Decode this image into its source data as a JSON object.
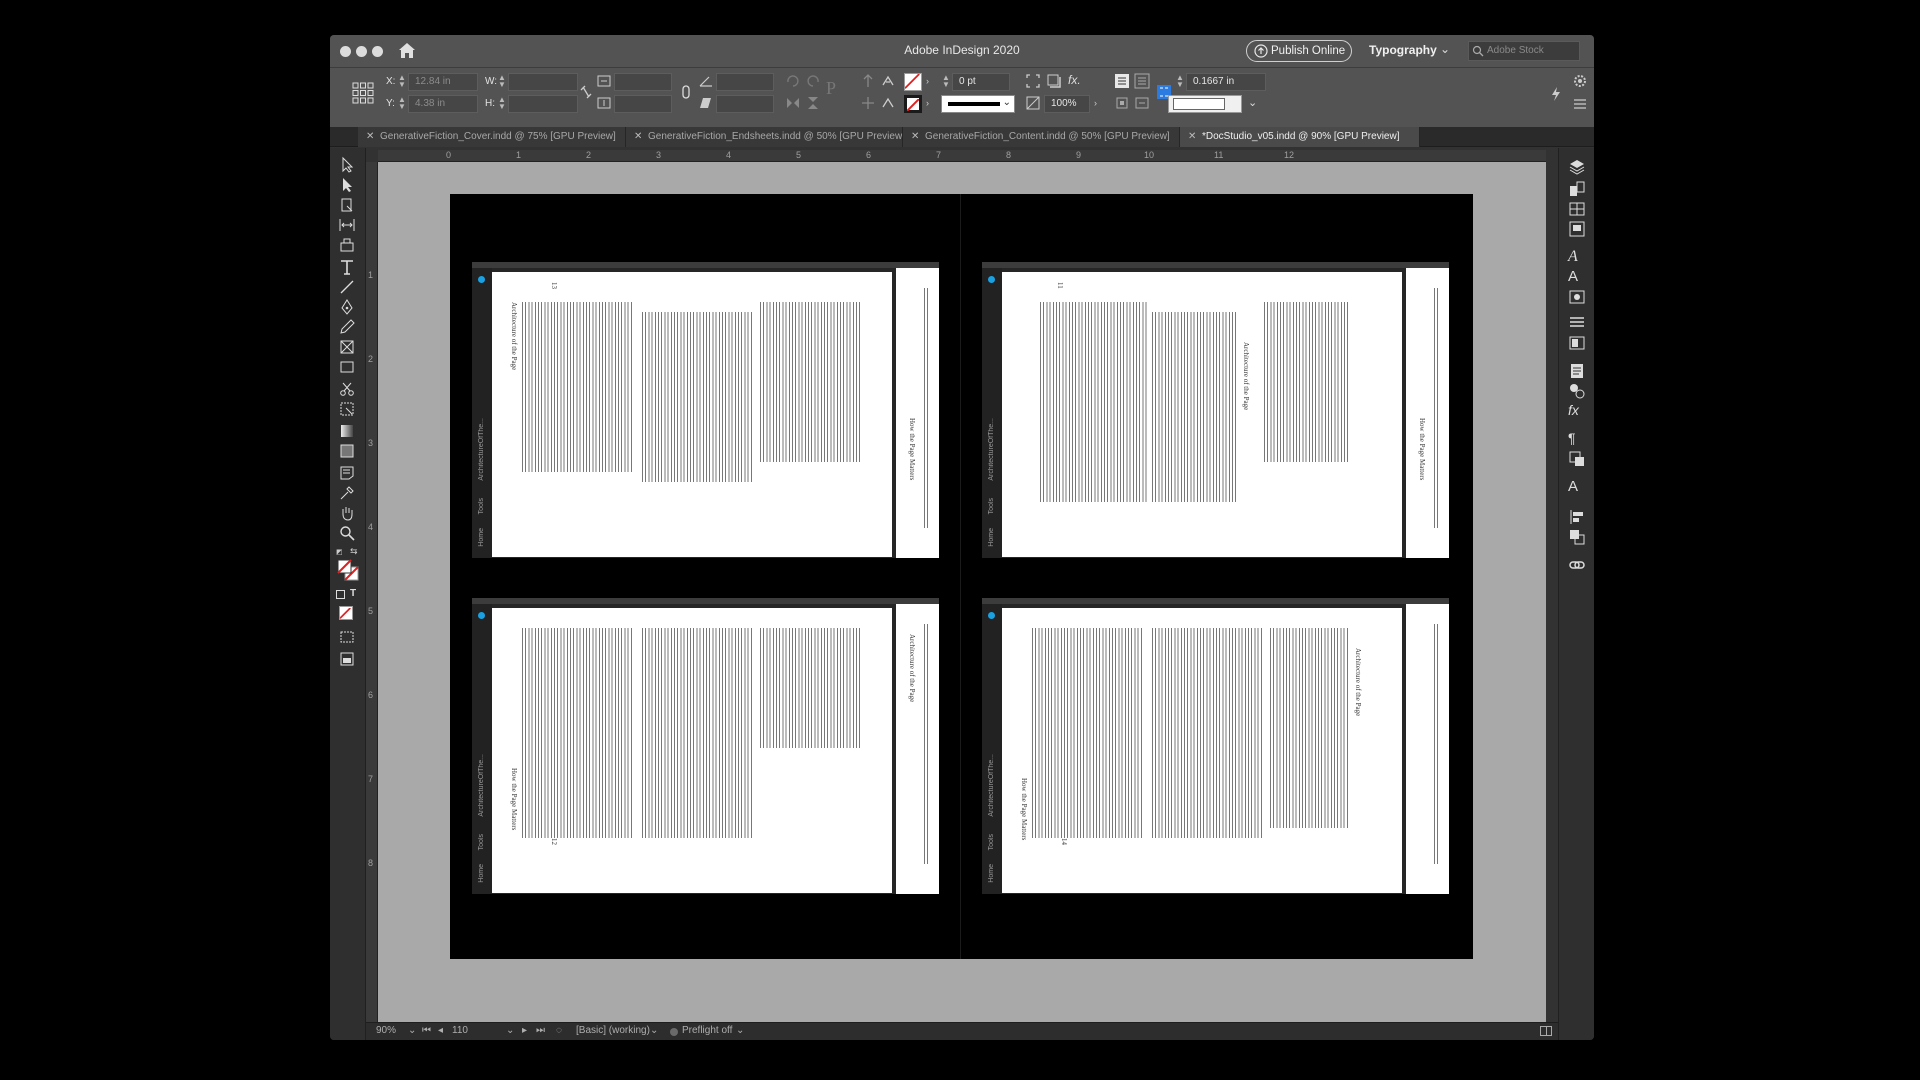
{
  "titlebar": {
    "title": "Adobe InDesign 2020",
    "publish_label": "Publish Online",
    "workspace_label": "Typography",
    "stock_placeholder": "Adobe Stock"
  },
  "control": {
    "x_label": "X:",
    "x_value": "12.84 in",
    "y_label": "Y:",
    "y_value": "4.38 in",
    "w_label": "W:",
    "h_label": "H:",
    "stroke_weight": "0 pt",
    "scale_percent": "100%",
    "gap_value": "0.1667 in"
  },
  "tabs": [
    {
      "label": "GenerativeFiction_Cover.indd @ 75% [GPU Preview]",
      "active": false
    },
    {
      "label": "GenerativeFiction_Endsheets.indd @ 50% [GPU Preview]",
      "active": false
    },
    {
      "label": "GenerativeFiction_Content.indd @ 50% [GPU Preview]",
      "active": false
    },
    {
      "label": "*DocStudio_v05.indd @ 90% [GPU Preview]",
      "active": true
    }
  ],
  "ruler_h": [
    "0",
    "1",
    "2",
    "3",
    "4",
    "5",
    "6",
    "7",
    "8",
    "9",
    "10",
    "11",
    "12"
  ],
  "ruler_v": [
    "1",
    "2",
    "3",
    "4",
    "5",
    "6",
    "7",
    "8"
  ],
  "frames": [
    {
      "running_head": "Architecture of the Page",
      "page_number": "13",
      "side_label": "ArchitectureOfThe...",
      "side_tabs": [
        "Home",
        "Tools"
      ],
      "right_text": "How the Page Matters"
    },
    {
      "running_head": "Architecture of the Page",
      "page_number": "11",
      "side_label": "ArchitectureOfThe...",
      "side_tabs": [
        "Home",
        "Tools"
      ],
      "right_text": "How the Page Matters"
    },
    {
      "running_head": "How the Page Matters",
      "page_number": "12",
      "side_label": "ArchitectureOfThe...",
      "side_tabs": [
        "Home",
        "Tools"
      ],
      "right_text": "Architecture of the Page"
    },
    {
      "running_head": "How the Page Matters",
      "page_number": "14",
      "side_label": "ArchitectureOfThe...",
      "side_tabs": [
        "Home",
        "Tools"
      ],
      "right_text": "Architecture of the Page"
    }
  ],
  "status": {
    "zoom": "90%",
    "page": "110",
    "style": "[Basic] (working)",
    "preflight": "Preflight off"
  },
  "colors": {
    "accent_dot": "#1aa1e1",
    "chrome": "#535353",
    "pasteboard": "#a9a9a9"
  }
}
